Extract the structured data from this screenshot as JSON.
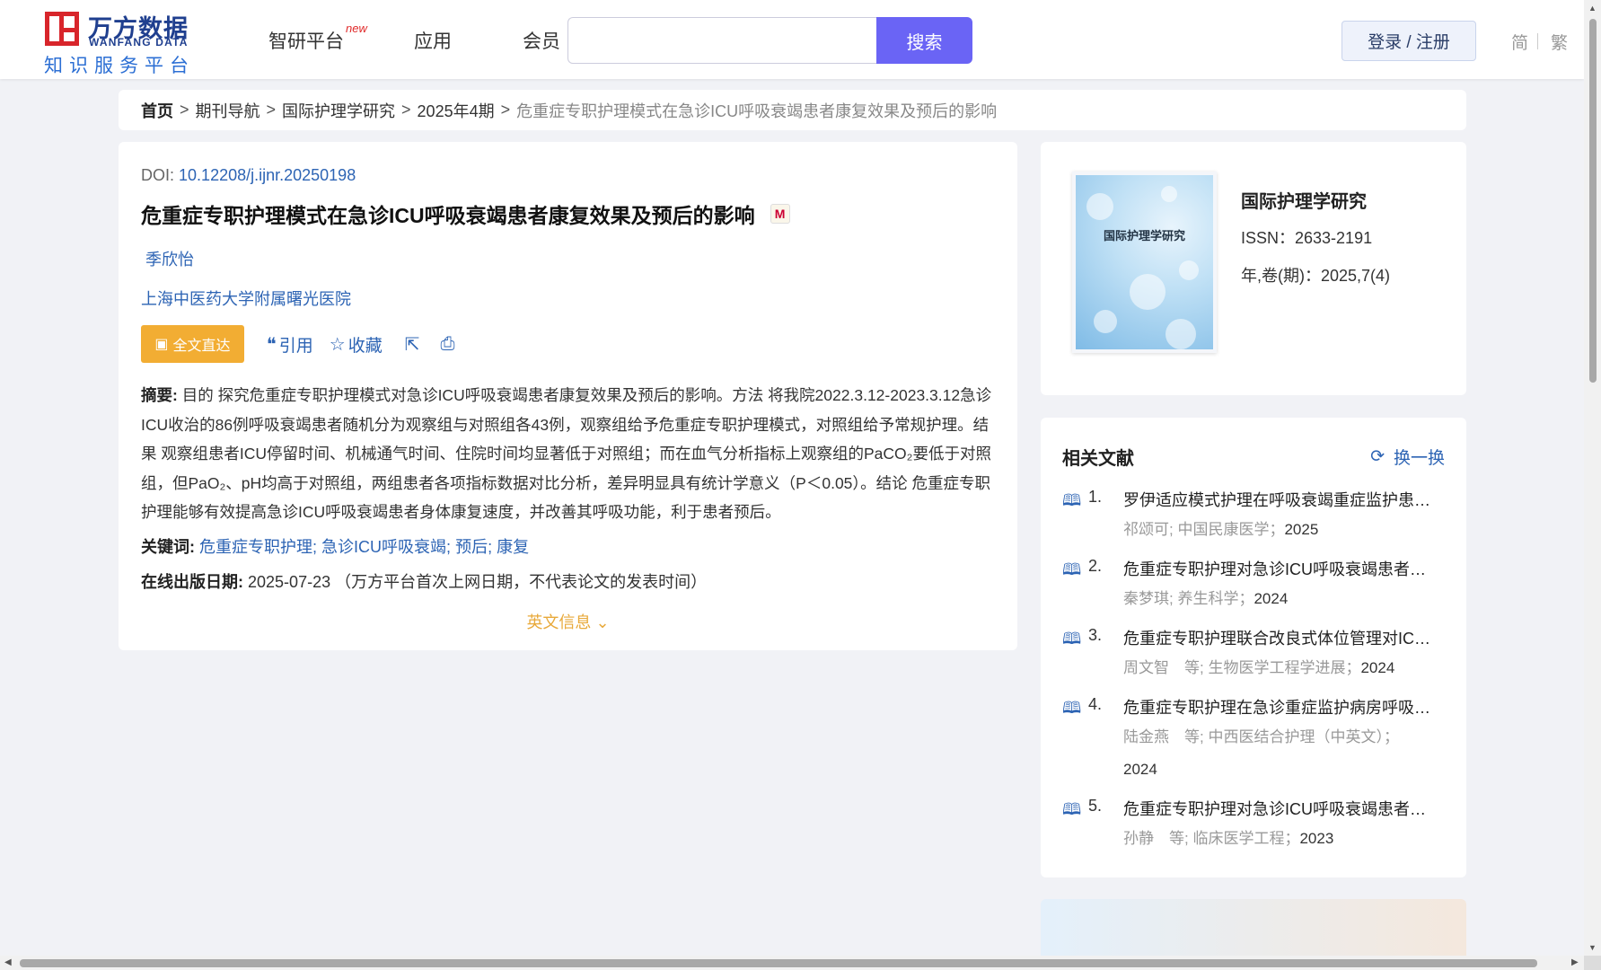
{
  "header": {
    "logo_cn": "万方数据",
    "logo_en": "WANFANG DATA",
    "logo_sub": "知识服务平台",
    "nav": [
      {
        "label": "智研平台",
        "badge": "new"
      },
      {
        "label": "应用"
      },
      {
        "label": "会员"
      }
    ],
    "search_placeholder": "",
    "search_label": "搜索",
    "login_label": "登录 / 注册",
    "lang_simplified": "简",
    "lang_traditional": "繁"
  },
  "breadcrumb": {
    "home": "首页",
    "items": [
      "期刊导航",
      "国际护理学研究",
      "2025年4期"
    ],
    "current": "危重症专职护理模式在急诊ICU呼吸衰竭患者康复效果及预后的影响",
    "separator": ">"
  },
  "article": {
    "doi_label": "DOI:",
    "doi": "10.12208/j.ijnr.20250198",
    "title": "危重症专职护理模式在急诊ICU呼吸衰竭患者康复效果及预后的影响",
    "m_badge": "M",
    "author": "季欣怡",
    "affiliation": "上海中医药大学附属曙光医院",
    "actions": {
      "fulltext": "全文直达",
      "cite": "引用",
      "favorite": "收藏"
    },
    "abstract_label": "摘要:",
    "abstract": "目的 探究危重症专职护理模式对急诊ICU呼吸衰竭患者康复效果及预后的影响。方法 将我院2022.3.12-2023.3.12急诊ICU收治的86例呼吸衰竭患者随机分为观察组与对照组各43例，观察组给予危重症专职护理模式，对照组给予常规护理。结果 观察组患者ICU停留时间、机械通气时间、住院时间均显著低于对照组；而在血气分析指标上观察组的PaCO₂要低于对照组，但PaO₂、pH均高于对照组，两组患者各项指标数据对比分析，差异明显具有统计学意义（P＜0.05）。结论 危重症专职护理能够有效提高急诊ICU呼吸衰竭患者身体康复速度，并改善其呼吸功能，利于患者预后。",
    "keywords_label": "关键词:",
    "keywords": [
      "危重症专职护理",
      "急诊ICU呼吸衰竭",
      "预后",
      "康复"
    ],
    "pubdate_label": "在线出版日期:",
    "pubdate": "2025-07-23",
    "pubdate_note": "（万方平台首次上网日期，不代表论文的发表时间）",
    "english_info": "英文信息"
  },
  "journal": {
    "cover_title": "国际护理学研究",
    "name": "国际护理学研究",
    "issn": "ISSN：2633-2191",
    "volume": "年,卷(期)：2025,7(4)"
  },
  "related": {
    "title": "相关文献",
    "refresh": "换一换",
    "items": [
      {
        "num": "1.",
        "title": "罗伊适应模式护理在呼吸衰竭重症监护患儿...",
        "meta": "祁颂可; 中国民康医学；",
        "year": "2025"
      },
      {
        "num": "2.",
        "title": "危重症专职护理对急诊ICU呼吸衰竭患者康...",
        "meta": "秦梦琪; 养生科学；",
        "year": "2024"
      },
      {
        "num": "3.",
        "title": "危重症专职护理联合改良式体位管理对ICU...",
        "meta": "周文智　等;  生物医学工程学进展；",
        "year": "2024"
      },
      {
        "num": "4.",
        "title": "危重症专职护理在急诊重症监护病房呼吸衰...",
        "meta": "陆金燕　等;  中西医结合护理（中英文）；",
        "year": "2024"
      },
      {
        "num": "5.",
        "title": "危重症专职护理对急诊ICU呼吸衰竭患者康...",
        "meta": "孙静　等;  临床医学工程；",
        "year": "2023"
      }
    ]
  },
  "colors": {
    "accent": "#6a64f5",
    "link": "#2d64b4",
    "fulltext": "#f2ad33",
    "brand_red": "#d8252b"
  }
}
